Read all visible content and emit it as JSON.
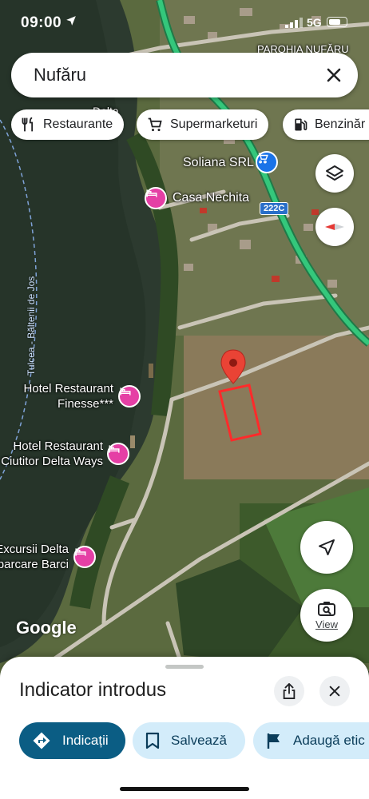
{
  "status_bar": {
    "time": "09:00",
    "network": "5G"
  },
  "search": {
    "query": "Nufăru"
  },
  "chips": [
    {
      "label": "Restaurante",
      "icon": "fork-knife-icon"
    },
    {
      "label": "Supermarketuri",
      "icon": "cart-icon"
    },
    {
      "label": "Benzinăr",
      "icon": "fuel-icon"
    }
  ],
  "map": {
    "labels": {
      "parohia": "PAROHIA NUFĂRU",
      "soliana": "Soliana SRL",
      "casa_nechita": "Casa Nechita",
      "road_number": "222C",
      "river": "Tulcea - Băltenii de Jos",
      "hotel_finesse_line1": "Hotel Restaurant",
      "hotel_finesse_line2": "Finesse***",
      "hotel_delta_line1": "Hotel Restaurant",
      "hotel_delta_line2": "Ciutitor Delta Ways",
      "excursii_line1": "Excursii Delta",
      "excursii_line2": "Îmbarcare Barci",
      "partial_top": "Delta",
      "google": "Google"
    },
    "view_button_label": "View",
    "marker_color": "#ea4335",
    "outline_color": "#ff2a2a",
    "highway_color": "#34c77b"
  },
  "sheet": {
    "title": "Indicator introdus",
    "actions": [
      {
        "label": "Indicații",
        "icon": "directions-icon"
      },
      {
        "label": "Salvează",
        "icon": "bookmark-icon"
      },
      {
        "label": "Adaugă etic",
        "icon": "flag-icon"
      }
    ]
  },
  "colors": {
    "primary": "#0b5d84",
    "secondary": "#d3ecfa",
    "hotel_pin": "#e53fa5",
    "shop_pin": "#1a73e8"
  }
}
